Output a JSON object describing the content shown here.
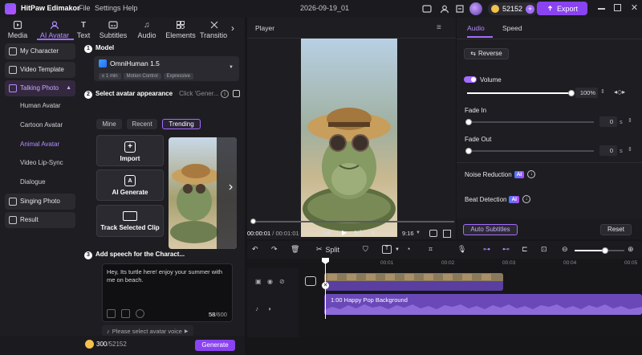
{
  "app": {
    "name": "HitPaw Edimakor",
    "menus": [
      "File",
      "Settings",
      "Help"
    ],
    "project_title": "2026-09-19_01",
    "credits": "52152",
    "export_label": "Export"
  },
  "toolbar_tabs": [
    {
      "label": "Media",
      "icon": "media-icon"
    },
    {
      "label": "AI Avatar",
      "icon": "ai-avatar-icon"
    },
    {
      "label": "Text",
      "icon": "text-icon"
    },
    {
      "label": "Subtitles",
      "icon": "subtitles-icon"
    },
    {
      "label": "Audio",
      "icon": "audio-icon"
    },
    {
      "label": "Elements",
      "icon": "elements-icon"
    },
    {
      "label": "Transitio",
      "icon": "transition-icon"
    }
  ],
  "sidebar": {
    "items": [
      {
        "label": "My Character"
      },
      {
        "label": "Video Template"
      },
      {
        "label": "Talking Photo"
      },
      {
        "label": "Singing Photo"
      },
      {
        "label": "Result"
      }
    ],
    "sub_items": [
      "Human Avatar",
      "Cartoon Avatar",
      "Animal Avatar",
      "Video Lip-Sync",
      "Dialogue"
    ]
  },
  "model": {
    "section_num": "1",
    "section_title": "Model",
    "name": "OmniHuman 1.5",
    "tags": [
      "≤ 1 min",
      "Motion Control",
      "Expressive"
    ]
  },
  "appearance": {
    "section_num": "2",
    "section_title": "Select avatar appearance",
    "hint": "Click 'Gener...",
    "tabs": [
      "Mine",
      "Recent",
      "Trending"
    ],
    "active_tab": "Trending",
    "cards": [
      {
        "label": "Import"
      },
      {
        "label": "AI Generate"
      },
      {
        "label": "Track Selected Clip"
      }
    ]
  },
  "speech": {
    "section_num": "3",
    "section_title": "Add speech for the Charact...",
    "text": "Hey, Its turtle here! enjoy your summer with me on beach.",
    "count": "58",
    "max": "/600",
    "voice_placeholder": "Please select avatar voice"
  },
  "bottom": {
    "credits_used": "300",
    "credits_total": "/52152",
    "generate_label": "Generate"
  },
  "player": {
    "title": "Player",
    "time_current": "00:00:01",
    "time_total": "/ 00:01:01",
    "aspect": "9:16"
  },
  "right_panel": {
    "tabs": [
      "Audio",
      "Speed"
    ],
    "active_tab": "Audio",
    "reverse_label": "Reverse",
    "volume_label": "Volume",
    "volume_value": "100%",
    "volume_level": 1.0,
    "fade_in_label": "Fade In",
    "fade_in_value": "0",
    "fade_out_label": "Fade Out",
    "fade_out_value": "0",
    "unit_s": "s",
    "noise_label": "Noise Reduction",
    "beat_label": "Beat Detection",
    "ai_badge": "AI",
    "auto_subtitles_label": "Auto Subtitles",
    "reset_label": "Reset"
  },
  "timeline": {
    "split_label": "Split",
    "ruler_ticks": [
      "00:01",
      "00:02",
      "00:03",
      "00:04",
      "00:05"
    ],
    "audio_clip_label": "1:00 Happy Pop Background",
    "zoom_level": 0.62
  },
  "colors": {
    "accent": "#8a43f0",
    "accent_light": "#b58bff",
    "bg": "#1e1e22"
  }
}
